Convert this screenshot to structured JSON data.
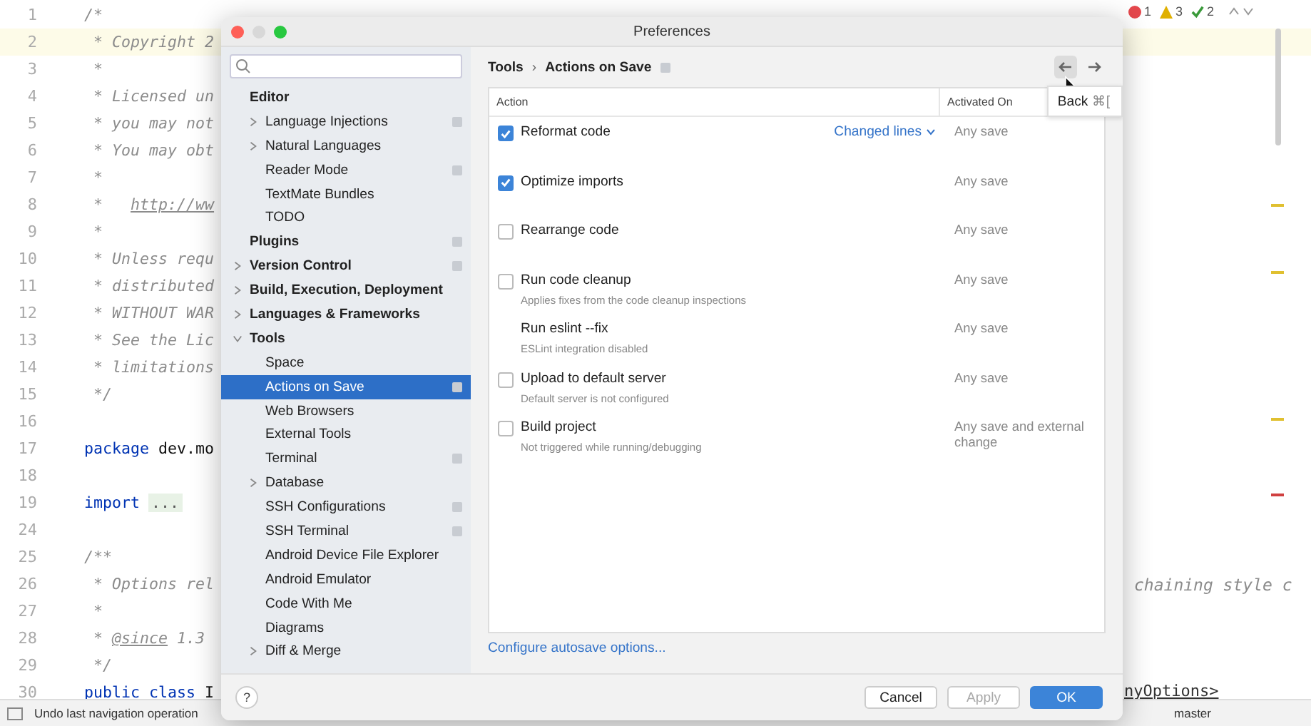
{
  "editor": {
    "lines": [
      {
        "num": "1",
        "parts": [
          {
            "text": "/*",
            "kind": "comment"
          }
        ]
      },
      {
        "num": "2",
        "current": true,
        "parts": [
          {
            "text": " * Copyright 2",
            "kind": "comment"
          }
        ]
      },
      {
        "num": "3",
        "parts": [
          {
            "text": " *",
            "kind": "comment"
          }
        ]
      },
      {
        "num": "4",
        "parts": [
          {
            "text": " * Licensed un",
            "kind": "comment"
          }
        ]
      },
      {
        "num": "5",
        "parts": [
          {
            "text": " * you may not",
            "kind": "comment"
          }
        ]
      },
      {
        "num": "6",
        "parts": [
          {
            "text": " * You may obt",
            "kind": "comment"
          }
        ]
      },
      {
        "num": "7",
        "parts": [
          {
            "text": " *",
            "kind": "comment"
          }
        ]
      },
      {
        "num": "8",
        "parts": [
          {
            "text": " *   ",
            "kind": "comment"
          },
          {
            "text": "http://ww",
            "kind": "link"
          }
        ]
      },
      {
        "num": "9",
        "parts": [
          {
            "text": " *",
            "kind": "comment"
          }
        ]
      },
      {
        "num": "10",
        "parts": [
          {
            "text": " * Unless requ",
            "kind": "comment"
          }
        ]
      },
      {
        "num": "11",
        "parts": [
          {
            "text": " * distributed",
            "kind": "comment"
          }
        ]
      },
      {
        "num": "12",
        "parts": [
          {
            "text": " * WITHOUT WAR",
            "kind": "comment"
          }
        ]
      },
      {
        "num": "13",
        "parts": [
          {
            "text": " * See the Lic",
            "kind": "comment"
          }
        ]
      },
      {
        "num": "14",
        "parts": [
          {
            "text": " * limitations",
            "kind": "comment"
          }
        ]
      },
      {
        "num": "15",
        "parts": [
          {
            "text": " */",
            "kind": "comment"
          }
        ]
      },
      {
        "num": "16"
      },
      {
        "num": "17",
        "parts": [
          {
            "text": "package",
            "kind": "keyword"
          },
          {
            "text": " dev.mo",
            "kind": "plain"
          }
        ]
      },
      {
        "num": "18"
      },
      {
        "num": "19",
        "parts": [
          {
            "text": "import",
            "kind": "keyword"
          },
          {
            "text": "...",
            "kind": "folded"
          }
        ]
      },
      {
        "num": "24"
      },
      {
        "num": "25",
        "parts": [
          {
            "text": "/**",
            "kind": "comment"
          }
        ]
      },
      {
        "num": "26",
        "parts": [
          {
            "text": " * Options rel",
            "kind": "comment"
          }
        ],
        "right_text": "chaining style c"
      },
      {
        "num": "27",
        "parts": [
          {
            "text": " *",
            "kind": "comment"
          }
        ]
      },
      {
        "num": "28",
        "parts": [
          {
            "text": " * ",
            "kind": "comment"
          },
          {
            "text": "@since",
            "kind": "tag"
          },
          {
            "text": " 1.3",
            "kind": "comment"
          }
        ]
      },
      {
        "num": "29",
        "parts": [
          {
            "text": " */",
            "kind": "comment"
          }
        ]
      },
      {
        "num": "30",
        "parts": [
          {
            "text": "public class",
            "kind": "keyword"
          },
          {
            "text": " I",
            "kind": "plain"
          }
        ]
      }
    ],
    "inspections": [
      {
        "kind": "error",
        "count": "1"
      },
      {
        "kind": "warning",
        "count": "3"
      },
      {
        "kind": "typo",
        "count": "2"
      }
    ],
    "breadcrumb": "nyOptions>"
  },
  "dialog": {
    "title": "Preferences",
    "sidebar": {
      "items": [
        {
          "label": "Editor",
          "bold": true,
          "selected": false,
          "children": [
            {
              "label": "Language Injections",
              "expanded": false,
              "badge": true,
              "selected": false
            },
            {
              "label": "Natural Languages",
              "expanded": false,
              "selected": false
            },
            {
              "label": "Reader Mode",
              "badge": true,
              "selected": false
            },
            {
              "label": "TextMate Bundles",
              "selected": false
            },
            {
              "label": "TODO",
              "selected": false
            }
          ]
        },
        {
          "label": "Plugins",
          "bold": true,
          "badge": true,
          "selected": false
        },
        {
          "label": "Version Control",
          "bold": true,
          "expanded": false,
          "badge": true,
          "selected": false
        },
        {
          "label": "Build, Execution, Deployment",
          "bold": true,
          "expanded": false,
          "selected": false
        },
        {
          "label": "Languages & Frameworks",
          "bold": true,
          "expanded": false,
          "selected": false
        },
        {
          "label": "Tools",
          "bold": true,
          "expanded": true,
          "selected": false,
          "children": [
            {
              "label": "Space",
              "selected": false
            },
            {
              "label": "Actions on Save",
              "selected": true,
              "badge": true
            },
            {
              "label": "Web Browsers",
              "selected": false
            },
            {
              "label": "External Tools",
              "selected": false
            },
            {
              "label": "Terminal",
              "badge": true,
              "selected": false
            },
            {
              "label": "Database",
              "expanded": false,
              "selected": false
            },
            {
              "label": "SSH Configurations",
              "badge": true,
              "selected": false
            },
            {
              "label": "SSH Terminal",
              "badge": true,
              "selected": false
            },
            {
              "label": "Android Device File Explorer",
              "selected": false
            },
            {
              "label": "Android Emulator",
              "selected": false
            },
            {
              "label": "Code With Me",
              "selected": false
            },
            {
              "label": "Diagrams",
              "selected": false
            },
            {
              "label": "Diff & Merge",
              "expanded": false,
              "selected": false
            }
          ]
        }
      ]
    },
    "breadcrumb": [
      "Tools",
      "Actions on Save"
    ],
    "breadcrumb_separator": "›",
    "tooltip": {
      "label": "Back",
      "shortcut": "⌘["
    },
    "table": {
      "columns": [
        "Action",
        "Activated On"
      ],
      "rows": [
        {
          "kind": "checkbox",
          "checked": true,
          "title": "Reformat code",
          "option": "Changed lines",
          "activated": "Any save"
        },
        {
          "kind": "checkbox",
          "checked": true,
          "title": "Optimize imports",
          "activated": "Any save"
        },
        {
          "kind": "checkbox",
          "checked": false,
          "title": "Rearrange code",
          "activated": "Any save"
        },
        {
          "kind": "checkbox",
          "checked": false,
          "title": "Run code cleanup",
          "subtitle": "Applies fixes from the code cleanup inspections",
          "activated": "Any save"
        },
        {
          "kind": "plain",
          "title": "Run eslint --fix",
          "subtitle": "ESLint integration disabled",
          "activated": "Any save"
        },
        {
          "kind": "checkbox",
          "checked": false,
          "title": "Upload to default server",
          "subtitle": "Default server is not configured",
          "activated": "Any save"
        },
        {
          "kind": "checkbox",
          "checked": false,
          "title": "Build project",
          "subtitle": "Not triggered while running/debugging",
          "activated": "Any save and external change"
        }
      ]
    },
    "link": "Configure autosave options...",
    "help": "?",
    "buttons": [
      {
        "label": "Cancel",
        "kind": "normal"
      },
      {
        "label": "Apply",
        "kind": "disabled"
      },
      {
        "label": "OK",
        "kind": "default"
      }
    ]
  },
  "status_bar": {
    "message": "Undo last navigation operation",
    "branch": "master"
  }
}
